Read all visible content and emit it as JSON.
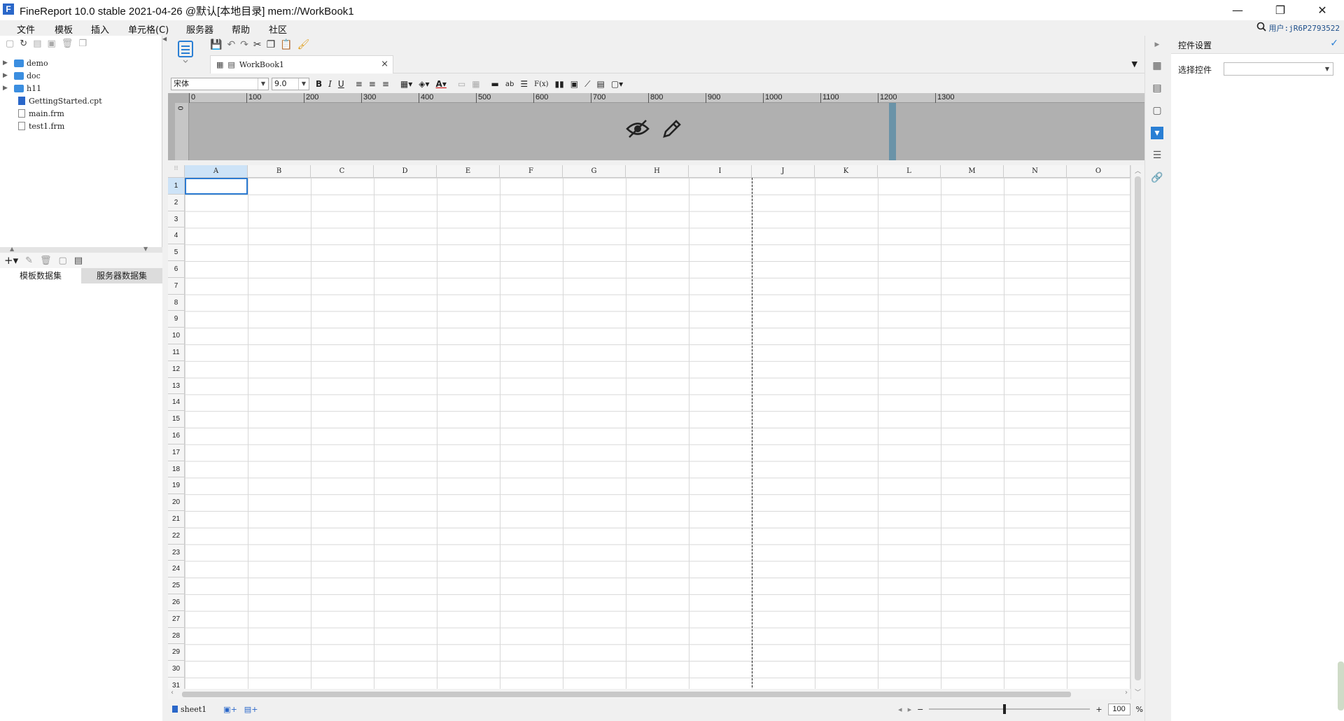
{
  "window": {
    "title": "FineReport 10.0 stable 2021-04-26 @默认[本地目录]    mem://WorkBook1",
    "logo": "F",
    "minimize": "—",
    "restore": "❐",
    "close": "✕"
  },
  "menu": {
    "items": [
      "文件",
      "模板",
      "插入",
      "单元格(C)",
      "服务器",
      "帮助",
      "社区"
    ],
    "user_label": "用户:jR6P2793522"
  },
  "tree": {
    "items": [
      {
        "label": "demo",
        "kind": "folder"
      },
      {
        "label": "doc",
        "kind": "folder"
      },
      {
        "label": "h11",
        "kind": "folder"
      },
      {
        "label": "GettingStarted.cpt",
        "kind": "cpt"
      },
      {
        "label": "main.frm",
        "kind": "frm"
      },
      {
        "label": "test1.frm",
        "kind": "frm"
      }
    ]
  },
  "dataset_tabs": {
    "template": "模板数据集",
    "server": "服务器数据集"
  },
  "document_tab": {
    "name": "WorkBook1",
    "close": "×"
  },
  "format_toolbar": {
    "font_name": "宋体",
    "font_size": "9.0",
    "bold": "B",
    "italic": "I",
    "underline": "U",
    "formula": "F(x)",
    "text_ab": "ab"
  },
  "ruler": {
    "ticks": [
      "0",
      "100",
      "200",
      "300",
      "400",
      "500",
      "600",
      "700",
      "800",
      "900",
      "1000",
      "1100",
      "1200",
      "1300"
    ],
    "vertical_zero": "0"
  },
  "grid": {
    "columns": [
      "A",
      "B",
      "C",
      "D",
      "E",
      "F",
      "G",
      "H",
      "I",
      "J",
      "K",
      "L",
      "M",
      "N",
      "O"
    ],
    "rows": [
      "1",
      "2",
      "3",
      "4",
      "5",
      "6",
      "7",
      "8",
      "9",
      "10",
      "11",
      "12",
      "13",
      "14",
      "15",
      "16",
      "17",
      "18",
      "19",
      "20",
      "21",
      "22",
      "23",
      "24",
      "25",
      "26",
      "27",
      "28",
      "29",
      "30",
      "31"
    ],
    "selected_cell": "A1"
  },
  "sheet_bar": {
    "sheet_name": "sheet1",
    "zoom_value": "100",
    "zoom_unit": "%",
    "zoom_minus": "−",
    "zoom_plus": "+"
  },
  "right_panel": {
    "title": "控件设置",
    "select_label": "选择控件",
    "select_value": ""
  },
  "colors": {
    "accent": "#2a7fd4",
    "param_pane": "#b0b0b0",
    "selected_header": "#cde3f7"
  }
}
